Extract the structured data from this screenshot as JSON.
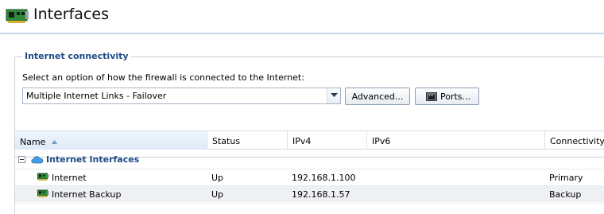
{
  "header": {
    "title": "Interfaces",
    "icon": "network-card-icon"
  },
  "connectivity": {
    "group_title": "Internet connectivity",
    "prompt": "Select an option of how the firewall is connected to the Internet:",
    "mode_value": "Multiple Internet Links - Failover",
    "advanced_label": "Advanced...",
    "ports_label": "Ports..."
  },
  "table": {
    "columns": [
      "Name",
      "Status",
      "IPv4",
      "IPv6",
      "Connectivity"
    ],
    "sorted_column": "Name",
    "group": {
      "label": "Internet Interfaces",
      "icon": "cloud-icon",
      "expanded": true
    },
    "rows": [
      {
        "name": "Internet",
        "status": "Up",
        "ipv4": "192.168.1.100",
        "ipv6": "",
        "connectivity": "Primary"
      },
      {
        "name": "Internet Backup",
        "status": "Up",
        "ipv4": "192.168.1.57",
        "ipv6": "",
        "connectivity": "Backup"
      }
    ]
  },
  "colors": {
    "accent": "#1f4b86",
    "header_rule": "#cfe0f2",
    "selected_row": "#eef0f3"
  }
}
